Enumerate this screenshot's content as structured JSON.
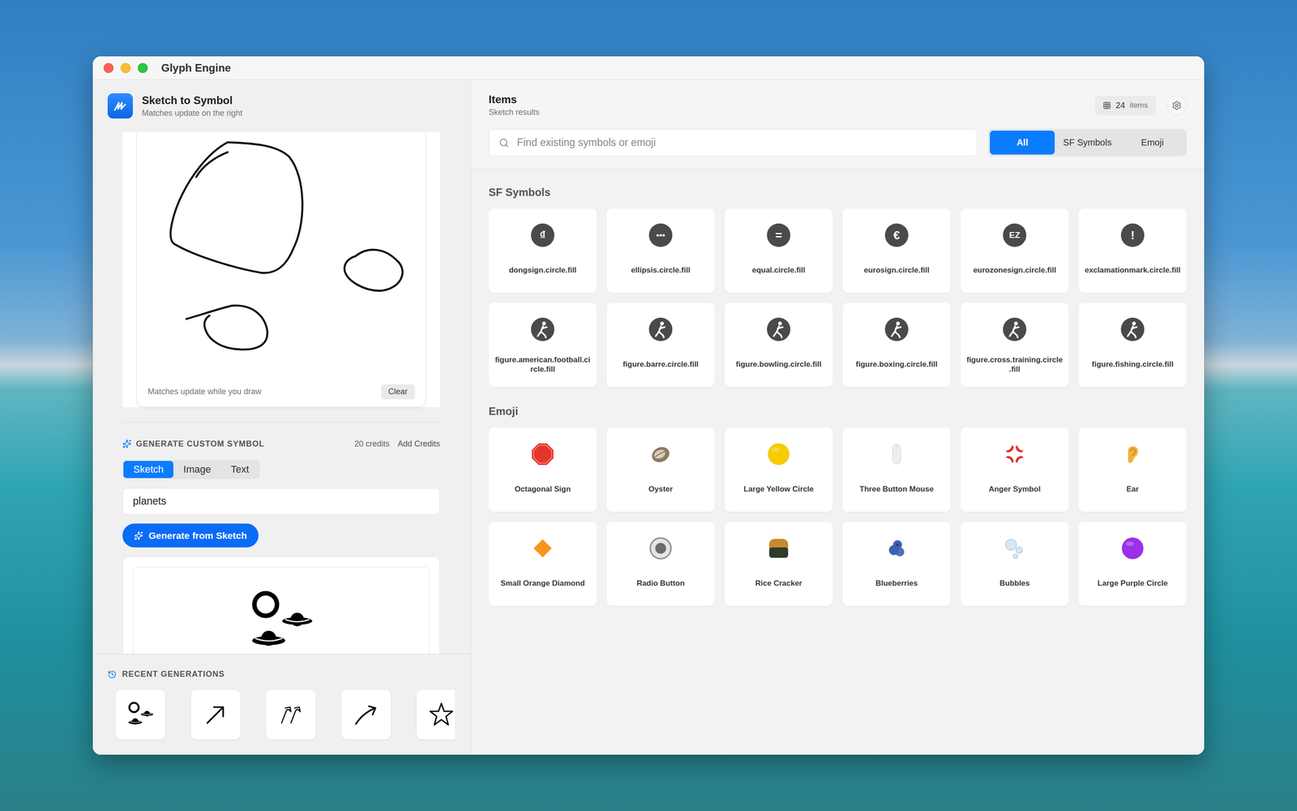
{
  "window": {
    "title": "Glyph Engine"
  },
  "sidebar": {
    "title": "Sketch to Symbol",
    "subtitle": "Matches update on the right",
    "canvas": {
      "hint": "Matches update while you draw",
      "clear": "Clear"
    },
    "generate": {
      "heading": "GENERATE CUSTOM SYMBOL",
      "credits": "20 credits",
      "add_credits": "Add Credits",
      "modes": [
        {
          "label": "Sketch",
          "selected": true
        },
        {
          "label": "Image",
          "selected": false
        },
        {
          "label": "Text",
          "selected": false
        }
      ],
      "prompt": "planets",
      "button": "Generate from Sketch"
    },
    "recent": {
      "heading": "RECENT GENERATIONS",
      "items": [
        {
          "kind": "planets"
        },
        {
          "kind": "arrow"
        },
        {
          "kind": "arrows"
        },
        {
          "kind": "curve"
        },
        {
          "kind": "star"
        }
      ]
    }
  },
  "content": {
    "title": "Items",
    "subtitle": "Sketch results",
    "count": "24",
    "count_label": "items",
    "search": {
      "placeholder": "Find existing symbols or emoji"
    },
    "filters": [
      {
        "label": "All",
        "selected": true
      },
      {
        "label": "SF Symbols",
        "selected": false
      },
      {
        "label": "Emoji",
        "selected": false
      }
    ],
    "sections": [
      {
        "title": "SF Symbols",
        "items": [
          {
            "name": "dongsign.circle.fill",
            "kind": "glyph",
            "glyph": "₫"
          },
          {
            "name": "ellipsis.circle.fill",
            "kind": "glyph",
            "glyph": "•••"
          },
          {
            "name": "equal.circle.fill",
            "kind": "glyph",
            "glyph": "="
          },
          {
            "name": "eurosign.circle.fill",
            "kind": "glyph",
            "glyph": "€"
          },
          {
            "name": "eurozonesign.circle.fill",
            "kind": "glyph",
            "glyph": "EZ"
          },
          {
            "name": "exclamationmark.circle.fill",
            "kind": "glyph",
            "glyph": "!"
          },
          {
            "name": "figure.american.football.circle.fill",
            "kind": "figure"
          },
          {
            "name": "figure.barre.circle.fill",
            "kind": "figure"
          },
          {
            "name": "figure.bowling.circle.fill",
            "kind": "figure"
          },
          {
            "name": "figure.boxing.circle.fill",
            "kind": "figure"
          },
          {
            "name": "figure.cross.training.circle.fill",
            "kind": "figure"
          },
          {
            "name": "figure.fishing.circle.fill",
            "kind": "figure"
          }
        ]
      },
      {
        "title": "Emoji",
        "items": [
          {
            "name": "Octagonal Sign",
            "kind": "octagon",
            "color": "#e8352b"
          },
          {
            "name": "Oyster",
            "kind": "oyster",
            "color": "#8a7a66"
          },
          {
            "name": "Large Yellow Circle",
            "kind": "circle",
            "color": "#f5cc00"
          },
          {
            "name": "Three Button Mouse",
            "kind": "mouse",
            "color": "#eeeeee"
          },
          {
            "name": "Anger Symbol",
            "kind": "anger",
            "color": "#e0312b"
          },
          {
            "name": "Ear",
            "kind": "ear",
            "color": "#f2b33d"
          },
          {
            "name": "Small Orange Diamond",
            "kind": "diamond",
            "color": "#f7941d"
          },
          {
            "name": "Radio Button",
            "kind": "radio",
            "color": "#6b6b6b"
          },
          {
            "name": "Rice Cracker",
            "kind": "cracker",
            "color": "#c98a2e"
          },
          {
            "name": "Blueberries",
            "kind": "berries",
            "color": "#3f5fb5"
          },
          {
            "name": "Bubbles",
            "kind": "bubbles",
            "color": "#d6e8f5"
          },
          {
            "name": "Large Purple Circle",
            "kind": "circle",
            "color": "#9b30e8"
          }
        ]
      }
    ]
  }
}
